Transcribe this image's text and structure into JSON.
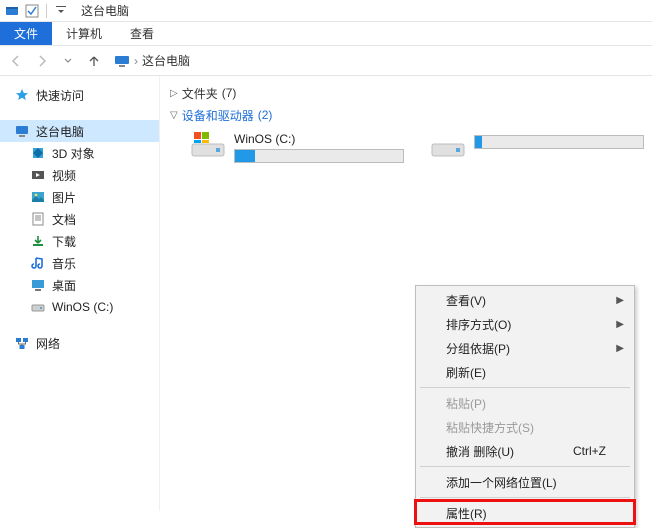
{
  "window": {
    "title": "这台电脑"
  },
  "menubar": {
    "file": "文件",
    "computer": "计算机",
    "view": "查看"
  },
  "address": {
    "location": "这台电脑"
  },
  "sidebar": {
    "quick_access": "快速访问",
    "this_pc": "这台电脑",
    "items": [
      {
        "label": "3D 对象"
      },
      {
        "label": "视频"
      },
      {
        "label": "图片"
      },
      {
        "label": "文档"
      },
      {
        "label": "下载"
      },
      {
        "label": "音乐"
      },
      {
        "label": "桌面"
      },
      {
        "label": "WinOS (C:)"
      }
    ],
    "network": "网络"
  },
  "content": {
    "folders": {
      "label": "文件夹",
      "count": "(7)"
    },
    "drives_header": {
      "label": "设备和驱动器",
      "count": "(2)"
    },
    "drives": [
      {
        "name": "WinOS (C:)",
        "fill_pct": 12,
        "has_logo": true
      },
      {
        "name": "",
        "fill_pct": 4,
        "has_logo": false
      }
    ]
  },
  "context_menu": {
    "items": [
      {
        "label": "查看(V)",
        "submenu": true
      },
      {
        "label": "排序方式(O)",
        "submenu": true
      },
      {
        "label": "分组依据(P)",
        "submenu": true
      },
      {
        "label": "刷新(E)"
      },
      {
        "sep": true
      },
      {
        "label": "粘贴(P)",
        "disabled": true
      },
      {
        "label": "粘贴快捷方式(S)",
        "disabled": true
      },
      {
        "label": "撤消 删除(U)",
        "shortcut": "Ctrl+Z"
      },
      {
        "sep": true
      },
      {
        "label": "添加一个网络位置(L)"
      },
      {
        "sep": true
      },
      {
        "label": "属性(R)",
        "highlight": true
      }
    ]
  }
}
